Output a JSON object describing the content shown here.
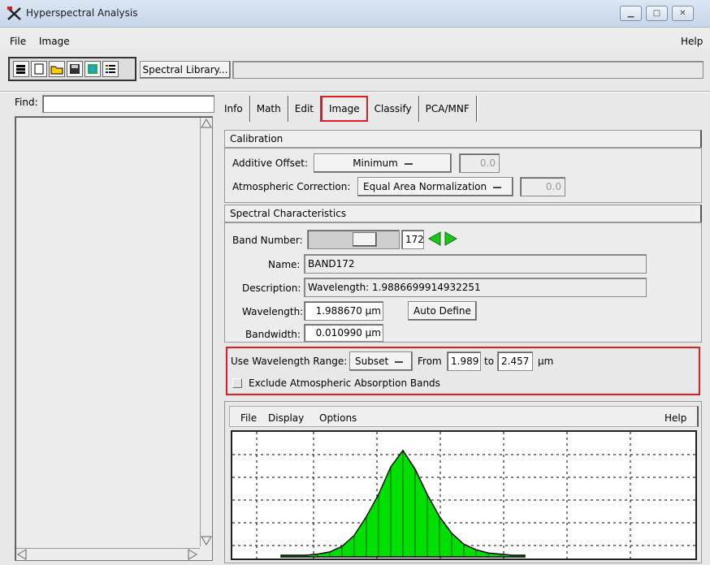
{
  "window": {
    "title": "Hyperspectral Analysis"
  },
  "menubar": {
    "file": "File",
    "image": "Image",
    "help": "Help"
  },
  "toolbar": {
    "spectral_library_label": "Spectral Library...",
    "spectral_library_value": ""
  },
  "find": {
    "label": "Find:",
    "value": ""
  },
  "tabs": [
    {
      "label": "Info"
    },
    {
      "label": "Math"
    },
    {
      "label": "Edit"
    },
    {
      "label": "Image"
    },
    {
      "label": "Classify"
    },
    {
      "label": "PCA/MNF"
    }
  ],
  "calibration": {
    "header": "Calibration",
    "additive_offset_label": "Additive Offset:",
    "additive_offset_value": "Minimum",
    "additive_offset_number": "0.0",
    "atmos_label": "Atmospheric Correction:",
    "atmos_value": "Equal Area Normalization",
    "atmos_number": "0.0"
  },
  "spectral": {
    "header": "Spectral Characteristics",
    "band_label": "Band Number:",
    "band_value": "172",
    "band_slider_fraction": 0.68,
    "name_label": "Name:",
    "name_value": "BAND172",
    "desc_label": "Description:",
    "desc_value": "Wavelength: 1.9886699914932251",
    "wavelength_label": "Wavelength:",
    "wavelength_value": "1.988670 µm",
    "auto_define": "Auto Define",
    "bandwidth_label": "Bandwidth:",
    "bandwidth_value": "0.010990 µm"
  },
  "range": {
    "use_label": "Use Wavelength Range:",
    "mode": "Subset",
    "from_label": "From",
    "from_value": "1.989",
    "to_label": "to",
    "to_value": "2.457",
    "unit": "µm",
    "exclude_label": "Exclude Atmospheric Absorption Bands",
    "exclude_checked": false
  },
  "plot": {
    "menu_file": "File",
    "menu_display": "Display",
    "menu_options": "Options",
    "menu_help": "Help",
    "fill_color": "#00e000",
    "line_color": "#000000"
  },
  "chart_data": {
    "type": "area",
    "x": [
      0,
      5,
      10,
      15,
      20,
      25,
      30,
      35,
      40,
      45,
      50,
      55,
      60,
      65,
      70,
      75,
      80,
      85,
      90,
      95,
      100
    ],
    "values": [
      0,
      0,
      0,
      1,
      3,
      8,
      18,
      35,
      55,
      80,
      95,
      78,
      55,
      35,
      20,
      10,
      5,
      2,
      1,
      0,
      0
    ]
  }
}
